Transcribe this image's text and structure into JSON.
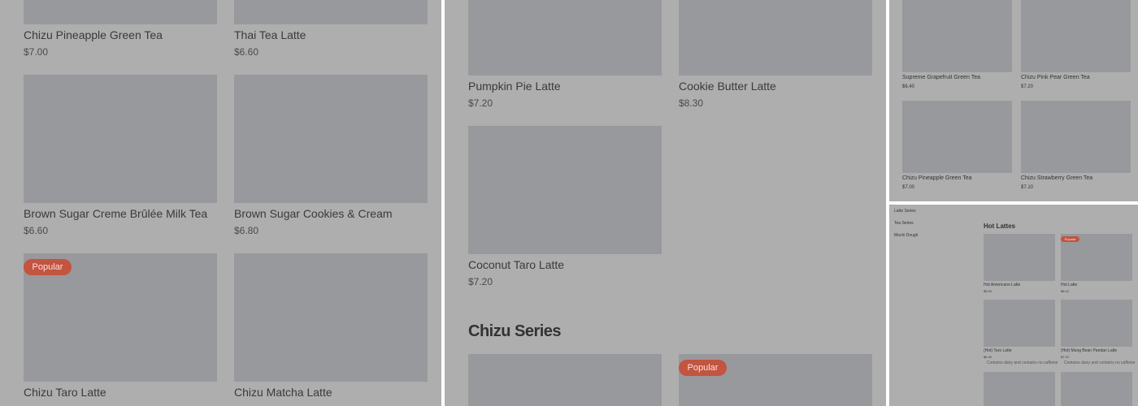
{
  "colors": {
    "panel_bg": "#aeaeae",
    "image_placeholder": "#98999c",
    "badge_bg": "#c4533f"
  },
  "panel1": {
    "items": [
      {
        "name": "Chizu Pineapple Green Tea",
        "price": "$7.00"
      },
      {
        "name": "Thai Tea Latte",
        "price": "$6.60"
      },
      {
        "name": "Brown Sugar Creme Brûlée Milk Tea",
        "price": "$6.60"
      },
      {
        "name": "Brown Sugar Cookies & Cream",
        "price": "$6.80"
      },
      {
        "name": "Chizu Taro Latte",
        "badge": "Popular"
      },
      {
        "name": "Chizu Matcha Latte"
      }
    ]
  },
  "panel2": {
    "items": [
      {
        "name": "Pumpkin Pie Latte",
        "price": "$7.20"
      },
      {
        "name": "Cookie Butter Latte",
        "price": "$8.30"
      },
      {
        "name": "Coconut Taro Latte",
        "price": "$7.20"
      }
    ],
    "section_title": "Chizu Series",
    "next_badge": "Popular"
  },
  "panel3": {
    "items": [
      {
        "name": "Supreme Grapefruit Green Tea",
        "price": "$6.40"
      },
      {
        "name": "Chizu Pink Pear Green Tea",
        "price": "$7.20"
      },
      {
        "name": "Chizu Pineapple Green Tea",
        "price": "$7.00"
      },
      {
        "name": "Chizu Strawberry Green Tea",
        "price": "$7.10"
      }
    ]
  },
  "panel4": {
    "nav": [
      "Latte Series",
      "Tea Series",
      "Mochi Dough"
    ],
    "section_title": "Hot Lattes",
    "items": [
      {
        "name": "Hot Americano Latte",
        "price": "$5.20"
      },
      {
        "name": "Hot Latte",
        "price": "$6.10",
        "badge": "Popular"
      },
      {
        "name": "(Hot) Taro Latte",
        "price": "$6.40",
        "note": "Contains dairy and contains no caffeine"
      },
      {
        "name": "(Hot) Mung Bean Pandan Latte",
        "price": "$7.10",
        "note": "Contains dairy and contains no caffeine"
      }
    ]
  }
}
